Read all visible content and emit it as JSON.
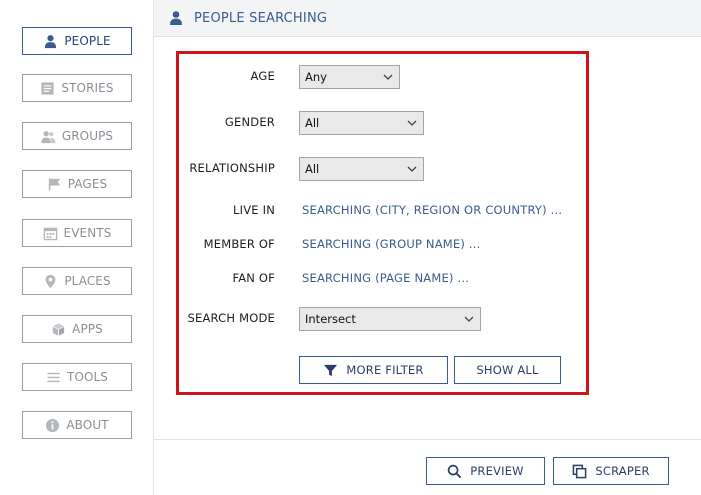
{
  "sidebar": {
    "items": [
      {
        "label": "PEOPLE",
        "icon": "person-icon",
        "active": true
      },
      {
        "label": "STORIES",
        "icon": "stories-icon",
        "active": false
      },
      {
        "label": "GROUPS",
        "icon": "groups-icon",
        "active": false
      },
      {
        "label": "PAGES",
        "icon": "flag-icon",
        "active": false
      },
      {
        "label": "EVENTS",
        "icon": "calendar-icon",
        "active": false
      },
      {
        "label": "PLACES",
        "icon": "location-pin-icon",
        "active": false
      },
      {
        "label": "APPS",
        "icon": "cube-icon",
        "active": false
      },
      {
        "label": "TOOLS",
        "icon": "menu-lines-icon",
        "active": false
      },
      {
        "label": "ABOUT",
        "icon": "info-icon",
        "active": false
      }
    ]
  },
  "header": {
    "title": "PEOPLE SEARCHING",
    "icon": "person-icon"
  },
  "filters": {
    "age": {
      "label": "AGE",
      "value": "Any"
    },
    "gender": {
      "label": "GENDER",
      "value": "All"
    },
    "relationship": {
      "label": "RELATIONSHIP",
      "value": "All"
    },
    "live_in": {
      "label": "LIVE IN",
      "link": "SEARCHING (CITY, REGION OR COUNTRY) ..."
    },
    "member_of": {
      "label": "MEMBER OF",
      "link": "SEARCHING (GROUP NAME) ..."
    },
    "fan_of": {
      "label": "FAN OF",
      "link": "SEARCHING (PAGE NAME) ..."
    },
    "search_mode": {
      "label": "SEARCH MODE",
      "value": "Intersect"
    },
    "more_filter_label": "MORE FILTER",
    "show_all_label": "SHOW ALL"
  },
  "footer": {
    "preview_label": "PREVIEW",
    "scraper_label": "SCRAPER"
  },
  "colors": {
    "accent": "#3b5b8e",
    "highlight_border": "#d0121b",
    "muted": "#8a8f96"
  }
}
